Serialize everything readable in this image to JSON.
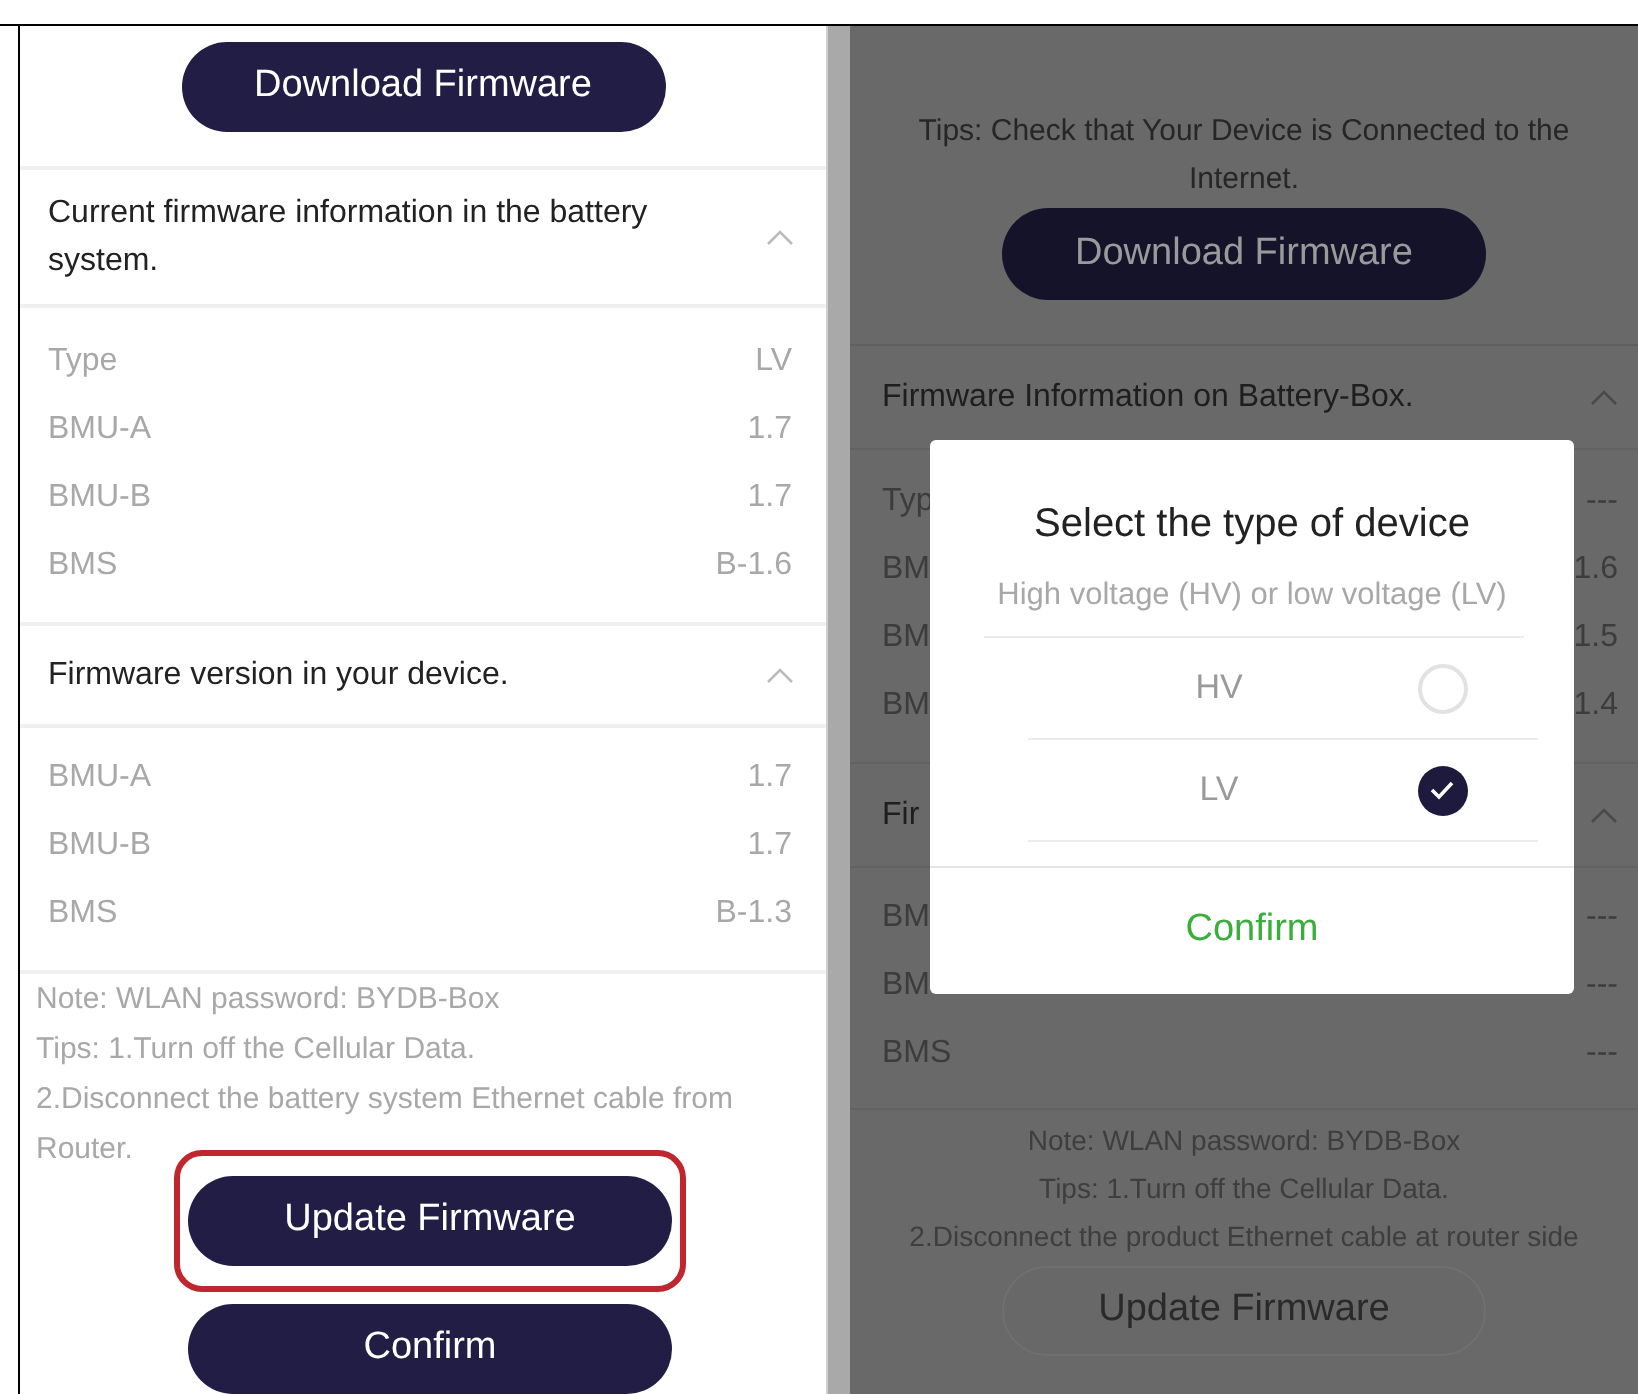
{
  "left_screen": {
    "download_button": "Download Firmware",
    "sections": [
      {
        "title": "Current firmware information in the battery system.",
        "expanded": true,
        "rows": [
          {
            "label": "Type",
            "value": "LV"
          },
          {
            "label": "BMU-A",
            "value": "1.7"
          },
          {
            "label": "BMU-B",
            "value": "1.7"
          },
          {
            "label": "BMS",
            "value": "B-1.6"
          }
        ]
      },
      {
        "title": "Firmware version in your device.",
        "expanded": true,
        "rows": [
          {
            "label": "BMU-A",
            "value": "1.7"
          },
          {
            "label": "BMU-B",
            "value": "1.7"
          },
          {
            "label": "BMS",
            "value": "B-1.3"
          }
        ]
      }
    ],
    "notes": [
      "Note: WLAN password: BYDB-Box",
      "Tips: 1.Turn off the Cellular Data.",
      "2.Disconnect the battery system Ethernet cable from Router."
    ],
    "update_button": {
      "label": "Update Firmware",
      "highlighted": true
    },
    "confirm_button": "Confirm"
  },
  "right_screen": {
    "tips": "Tips: Check that Your Device is Connected to the Internet.",
    "download_button": "Download Firmware",
    "sections": [
      {
        "title": "Firmware Information on Battery-Box.",
        "expanded": true,
        "rows": [
          {
            "label": "Typ",
            "value": "---"
          },
          {
            "label": "BM",
            "value": "1.6"
          },
          {
            "label": "BM",
            "value": "1.5"
          },
          {
            "label": "BM",
            "value": "1.4"
          }
        ]
      },
      {
        "title": "Fir",
        "expanded": true,
        "rows": [
          {
            "label": "BM",
            "value": "---"
          },
          {
            "label": "BM",
            "value": "---"
          },
          {
            "label": "BMS",
            "value": "---"
          }
        ]
      }
    ],
    "notes": [
      "Note: WLAN password: BYDB-Box",
      "Tips: 1.Turn off the Cellular Data.",
      "2.Disconnect the product Ethernet cable at router side"
    ],
    "update_button": "Update Firmware",
    "dialog": {
      "title": "Select the type of device",
      "subtitle": "High voltage (HV) or low voltage (LV)",
      "options": [
        {
          "label": "HV",
          "selected": false
        },
        {
          "label": "LV",
          "selected": true
        }
      ],
      "confirm": "Confirm"
    }
  }
}
